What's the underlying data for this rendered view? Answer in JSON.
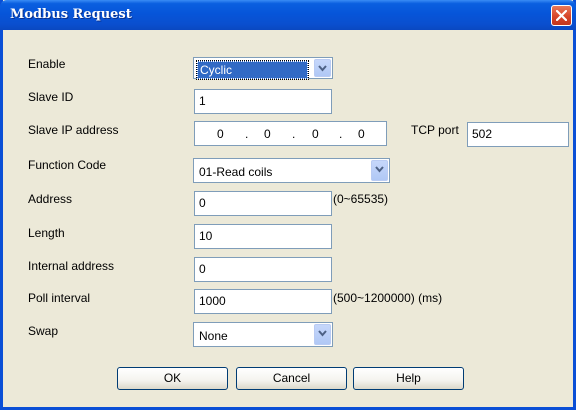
{
  "dialog": {
    "title": "Modbus Request"
  },
  "fields": {
    "enable": {
      "label": "Enable",
      "value": "Cyclic"
    },
    "slave_id": {
      "label": "Slave ID",
      "value": "1"
    },
    "slave_ip": {
      "label": "Slave IP address",
      "octets": [
        "0",
        "0",
        "0",
        "0"
      ],
      "separator": "."
    },
    "tcp_port": {
      "label": "TCP port",
      "value": "502"
    },
    "function_code": {
      "label": "Function Code",
      "value": "01-Read coils"
    },
    "address": {
      "label": "Address",
      "value": "0",
      "hint": "(0~65535)"
    },
    "length": {
      "label": "Length",
      "value": "10"
    },
    "internal_address": {
      "label": "Internal address",
      "value": "0"
    },
    "poll_interval": {
      "label": "Poll interval",
      "value": "1000",
      "hint": "(500~1200000) (ms)"
    },
    "swap": {
      "label": "Swap",
      "value": "None"
    }
  },
  "buttons": {
    "ok": "OK",
    "cancel": "Cancel",
    "help": "Help"
  },
  "icons": {
    "close": "close-icon",
    "dropdown": "chevron-down-icon"
  },
  "colors": {
    "titlebar": "#0655d9",
    "close_button": "#d7462a",
    "selection": "#316ac5",
    "field_border": "#7f9db9",
    "dialog_bg": "#ece9d8"
  }
}
